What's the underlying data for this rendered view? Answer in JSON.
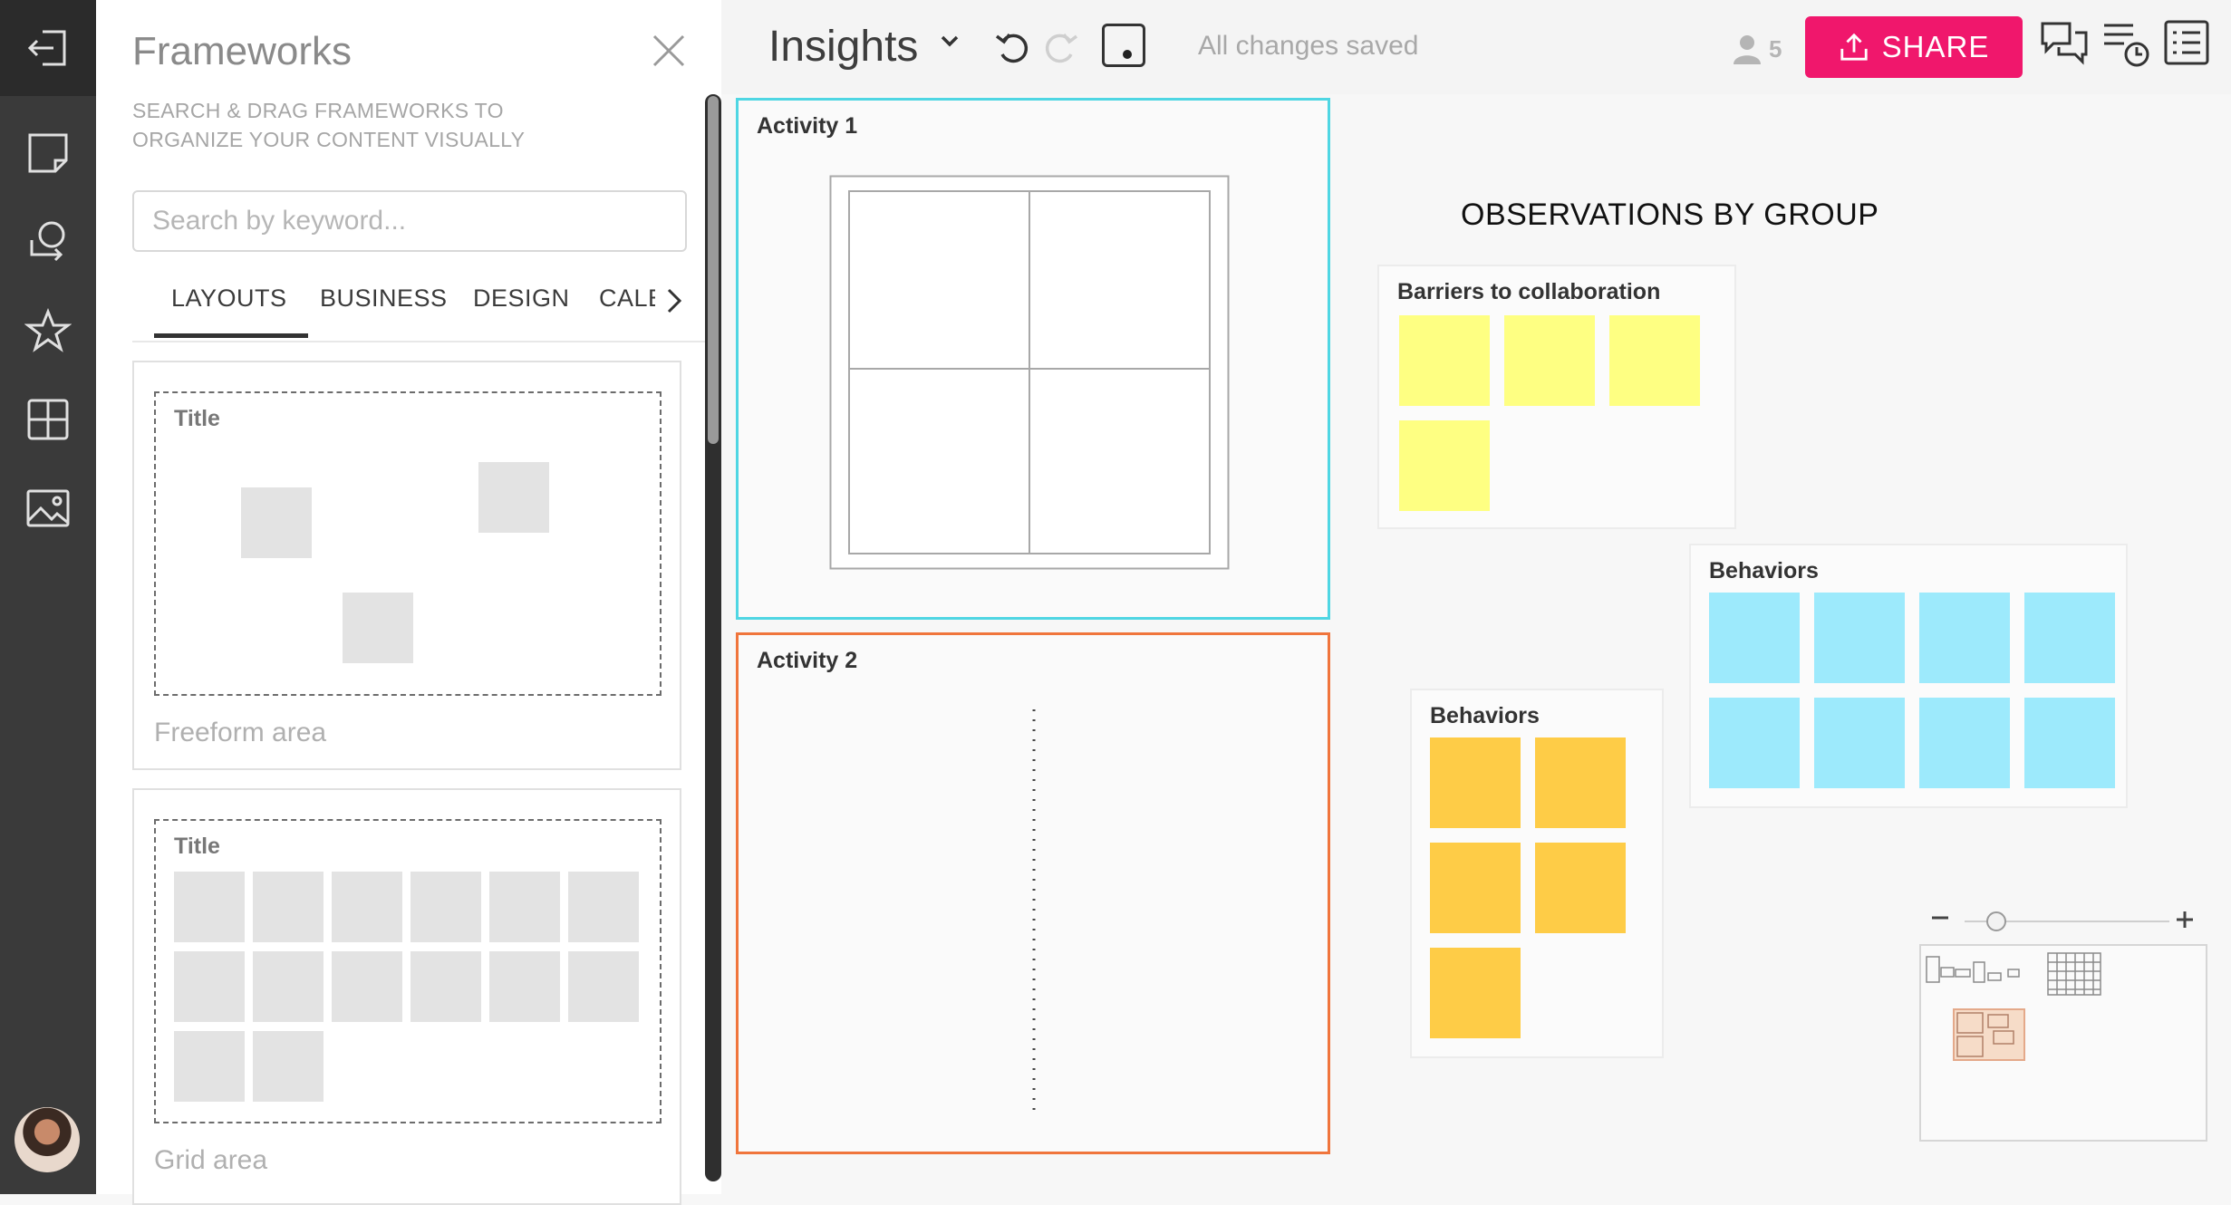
{
  "topbar": {
    "board_title": "Insights",
    "status": "All changes saved",
    "users_count": "5",
    "share_label": "SHARE"
  },
  "panel": {
    "title": "Frameworks",
    "subtitle_line1": "SEARCH & DRAG FRAMEWORKS TO",
    "subtitle_line2": "ORGANIZE YOUR CONTENT VISUALLY",
    "search_placeholder": "Search by keyword...",
    "tabs": [
      "LAYOUTS",
      "BUSINESS",
      "DESIGN",
      "CALENDAR"
    ],
    "active_tab": "LAYOUTS",
    "cards": [
      {
        "inner_title": "Title",
        "label": "Freeform area"
      },
      {
        "inner_title": "Title",
        "label": "Grid area"
      }
    ]
  },
  "canvas": {
    "activity1": "Activity 1",
    "activity2": "Activity 2",
    "observations_title": "OBSERVATIONS BY GROUP",
    "groups": [
      {
        "title": "Barriers to collaboration",
        "note_color": "#feff82",
        "notes": 4
      },
      {
        "title": "Behaviors",
        "note_color": "#9deafc",
        "notes": 8
      },
      {
        "title": "Behaviors",
        "note_color": "#fecc47",
        "notes": 5
      }
    ],
    "frame_colors": {
      "activity1": "#4fd6e3",
      "activity2": "#f0753c"
    }
  },
  "rail": {
    "icons": [
      "exit-icon",
      "sticky-note-icon",
      "search-shape-icon",
      "star-icon",
      "grid-icon",
      "image-icon"
    ]
  },
  "colors": {
    "accent": "#f0176c"
  }
}
